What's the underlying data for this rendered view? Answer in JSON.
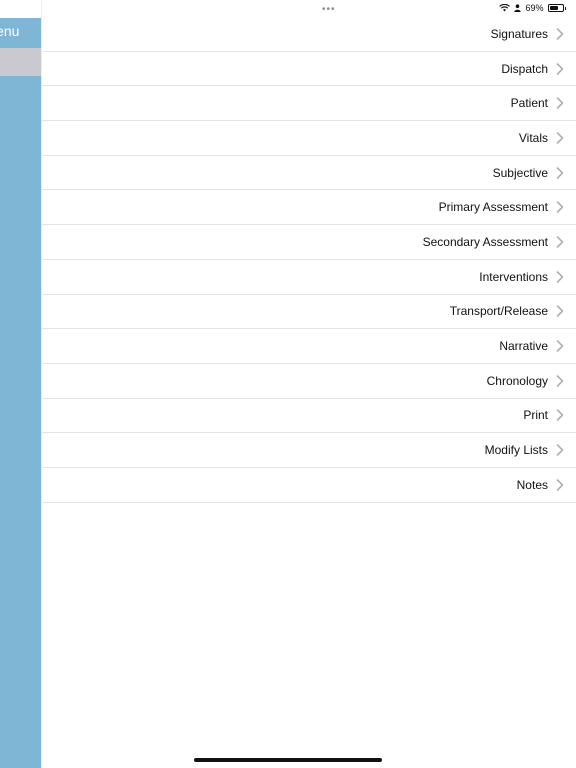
{
  "status_bar": {
    "battery_percent": "69%",
    "battery_level": 0.69,
    "multitask_dots": "•••"
  },
  "side_panel": {
    "title": "lenu"
  },
  "menu": {
    "items": [
      {
        "label": "Signatures"
      },
      {
        "label": "Dispatch"
      },
      {
        "label": "Patient"
      },
      {
        "label": "Vitals"
      },
      {
        "label": "Subjective"
      },
      {
        "label": "Primary Assessment"
      },
      {
        "label": "Secondary Assessment"
      },
      {
        "label": "Interventions"
      },
      {
        "label": "Transport/Release"
      },
      {
        "label": "Narrative"
      },
      {
        "label": "Chronology"
      },
      {
        "label": "Print"
      },
      {
        "label": "Modify Lists"
      },
      {
        "label": "Notes"
      }
    ]
  },
  "colors": {
    "side_panel": "#7fb6d6",
    "selected_row": "#c9c9cf",
    "chevron": "#b0b0b5",
    "separator": "#e3e3e6"
  },
  "icons": {
    "wifi": "wifi-icon",
    "person": "person-icon",
    "battery": "battery-icon",
    "chevron": "chevron-right-icon"
  }
}
